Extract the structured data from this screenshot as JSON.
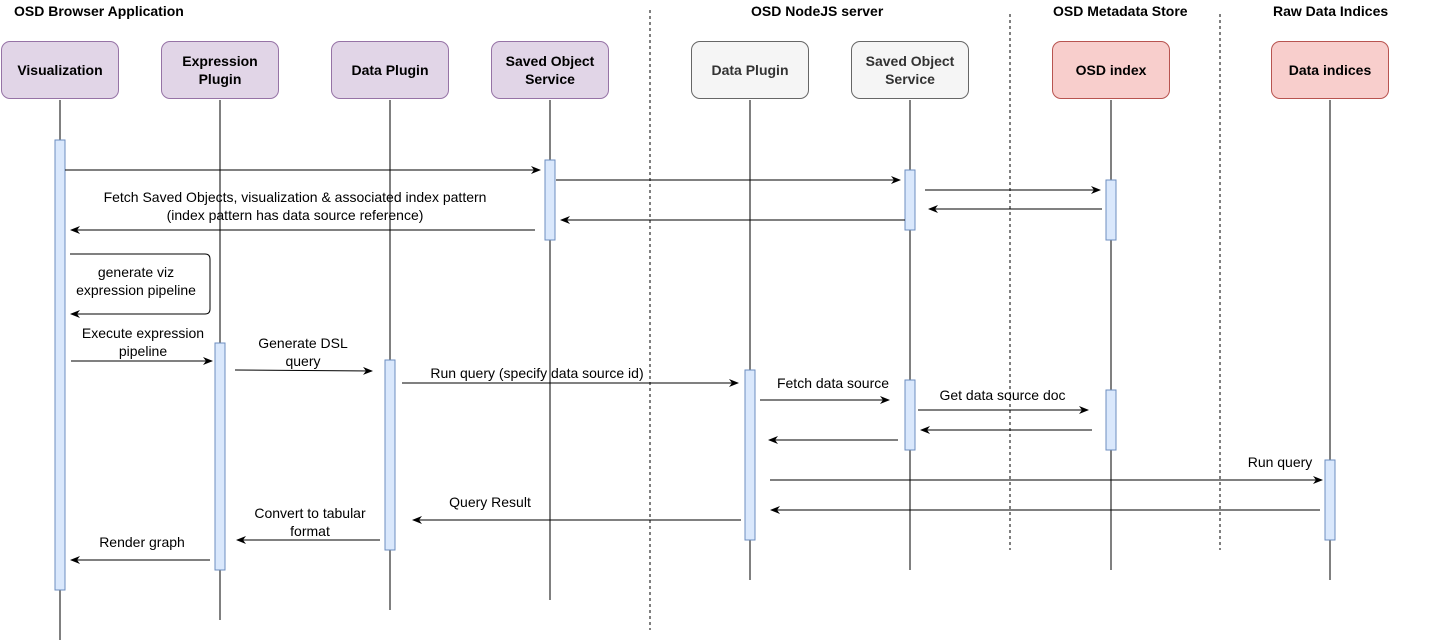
{
  "groups": [
    {
      "id": "browser",
      "title": "OSD Browser Application"
    },
    {
      "id": "server",
      "title": "OSD NodeJS server"
    },
    {
      "id": "metadata",
      "title": "OSD Metadata Store"
    },
    {
      "id": "raw",
      "title": "Raw Data Indices"
    }
  ],
  "actors": [
    {
      "id": "viz",
      "label": "Visualization",
      "group": "browser",
      "style": "purple"
    },
    {
      "id": "expr",
      "label": "Expression\nPlugin",
      "group": "browser",
      "style": "purple"
    },
    {
      "id": "data_b",
      "label": "Data Plugin",
      "group": "browser",
      "style": "purple"
    },
    {
      "id": "sos_b",
      "label": "Saved Object\nService",
      "group": "browser",
      "style": "purple"
    },
    {
      "id": "data_s",
      "label": "Data Plugin",
      "group": "server",
      "style": "gray"
    },
    {
      "id": "sos_s",
      "label": "Saved Object\nService",
      "group": "server",
      "style": "gray"
    },
    {
      "id": "osd_index",
      "label": "OSD index",
      "group": "metadata",
      "style": "red"
    },
    {
      "id": "data_idx",
      "label": "Data indices",
      "group": "raw",
      "style": "red"
    }
  ],
  "messages": [
    {
      "from": "viz",
      "to": "sos_b",
      "label": ""
    },
    {
      "from": "sos_b",
      "to": "sos_s",
      "label": ""
    },
    {
      "from": "sos_s",
      "to": "osd_index",
      "label": ""
    },
    {
      "from": "osd_index",
      "to": "sos_s",
      "label": ""
    },
    {
      "from": "sos_s",
      "to": "sos_b",
      "label": ""
    },
    {
      "from": "sos_b",
      "to": "viz",
      "label": "Fetch Saved Objects, visualization & associated index pattern\n(index pattern has data source reference)"
    },
    {
      "from": "viz",
      "to": "viz",
      "label": "generate viz\nexpression pipeline",
      "self": true
    },
    {
      "from": "viz",
      "to": "expr",
      "label": "Execute expression\npipeline"
    },
    {
      "from": "expr",
      "to": "data_b",
      "label": "Generate DSL\nquery"
    },
    {
      "from": "data_b",
      "to": "data_s",
      "label": "Run query (specify data source id)"
    },
    {
      "from": "data_s",
      "to": "sos_s",
      "label": "Fetch data source"
    },
    {
      "from": "sos_s",
      "to": "osd_index",
      "label": "Get data source doc"
    },
    {
      "from": "osd_index",
      "to": "sos_s",
      "label": ""
    },
    {
      "from": "sos_s",
      "to": "data_s",
      "label": ""
    },
    {
      "from": "data_s",
      "to": "data_idx",
      "label": "Run query"
    },
    {
      "from": "data_idx",
      "to": "data_s",
      "label": ""
    },
    {
      "from": "data_s",
      "to": "data_b",
      "label": "Query Result"
    },
    {
      "from": "data_b",
      "to": "expr",
      "label": "Convert to tabular\nformat"
    },
    {
      "from": "expr",
      "to": "viz",
      "label": "Render graph"
    }
  ],
  "colors": {
    "activation_fill": "#dae8fc",
    "activation_stroke": "#6c8ebf",
    "line": "#000000"
  }
}
